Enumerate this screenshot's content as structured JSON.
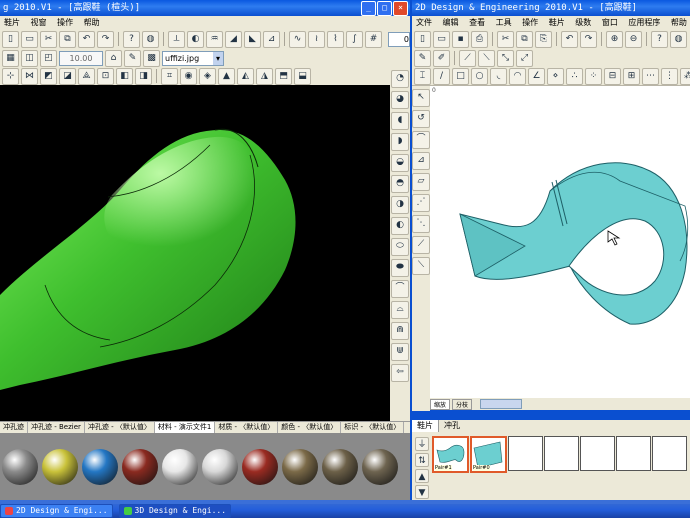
{
  "left_window": {
    "title": "g 2010.V1 - [高跟鞋 (楦头)]",
    "menu": [
      "鞋片",
      "视窗",
      "操作",
      "帮助"
    ],
    "zoom_value": "10.00",
    "texture_select": "uffizi.jpg",
    "status_strip": "0",
    "tabs": [
      "冲孔迹",
      "冲孔迹 - Bezier",
      "冲孔迹 - 〈默认值〉",
      "材料 - 演示文件1",
      "材质 - 〈默认值〉",
      "颜色 - 〈默认值〉",
      "标识 - 〈默认值〉"
    ],
    "material_colors": [
      "#8b8b8b",
      "#c9c23a",
      "#2477c4",
      "#8a2a20",
      "#e7e7e7",
      "#d8d8d8",
      "#9a2b22",
      "#7b6a48",
      "#6c6048",
      "#6e6450"
    ],
    "last_colors": {
      "shoe_green": "#3fbf2e",
      "viewport_bg": "#000000"
    }
  },
  "right_window": {
    "title": "2D Design & Engineering 2010.V1 - [高跟鞋]",
    "menu": [
      "文件",
      "编辑",
      "查看",
      "工具",
      "操作",
      "鞋片",
      "级数",
      "窗口",
      "应用程序",
      "帮助"
    ],
    "canvas_label": "0",
    "bottom_tabs": [
      "缩放",
      "分枝"
    ],
    "panel_tabs": [
      "鞋片",
      "冲孔"
    ],
    "pieces": [
      "Pair#1",
      "Pair#0"
    ],
    "piece_fill": "#6ccfd0"
  },
  "taskbar": {
    "buttons": [
      "2D Design & Engi...",
      "3D Design & Engi..."
    ]
  }
}
